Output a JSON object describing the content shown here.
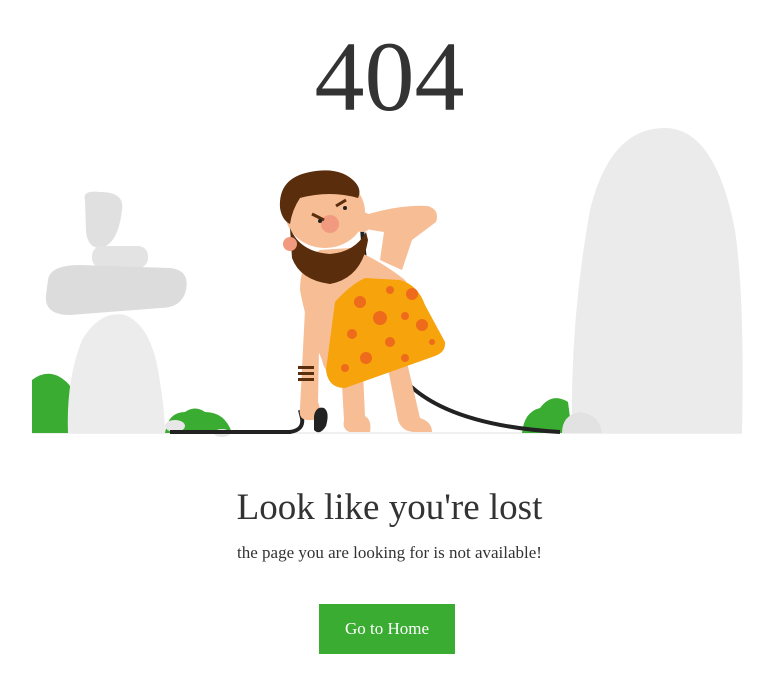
{
  "error": {
    "code": "404"
  },
  "message": {
    "title": "Look like you're lost",
    "subtitle": "the page you are looking for is not available!"
  },
  "action": {
    "home_label": "Go to Home"
  },
  "colors": {
    "button_bg": "#39ac31",
    "text": "#333333",
    "rock": "#e7e7e7",
    "bush": "#39ac31",
    "skin": "#f7bd95",
    "hair": "#5a2d0c",
    "outfit": "#f7a30c",
    "spots": "#ee6b1c"
  },
  "illustration": {
    "subject": "caveman-with-cable",
    "icons": [
      "stacked-rocks-icon",
      "boulder-icon",
      "bush-icon",
      "caveman-icon",
      "cable-icon"
    ]
  }
}
